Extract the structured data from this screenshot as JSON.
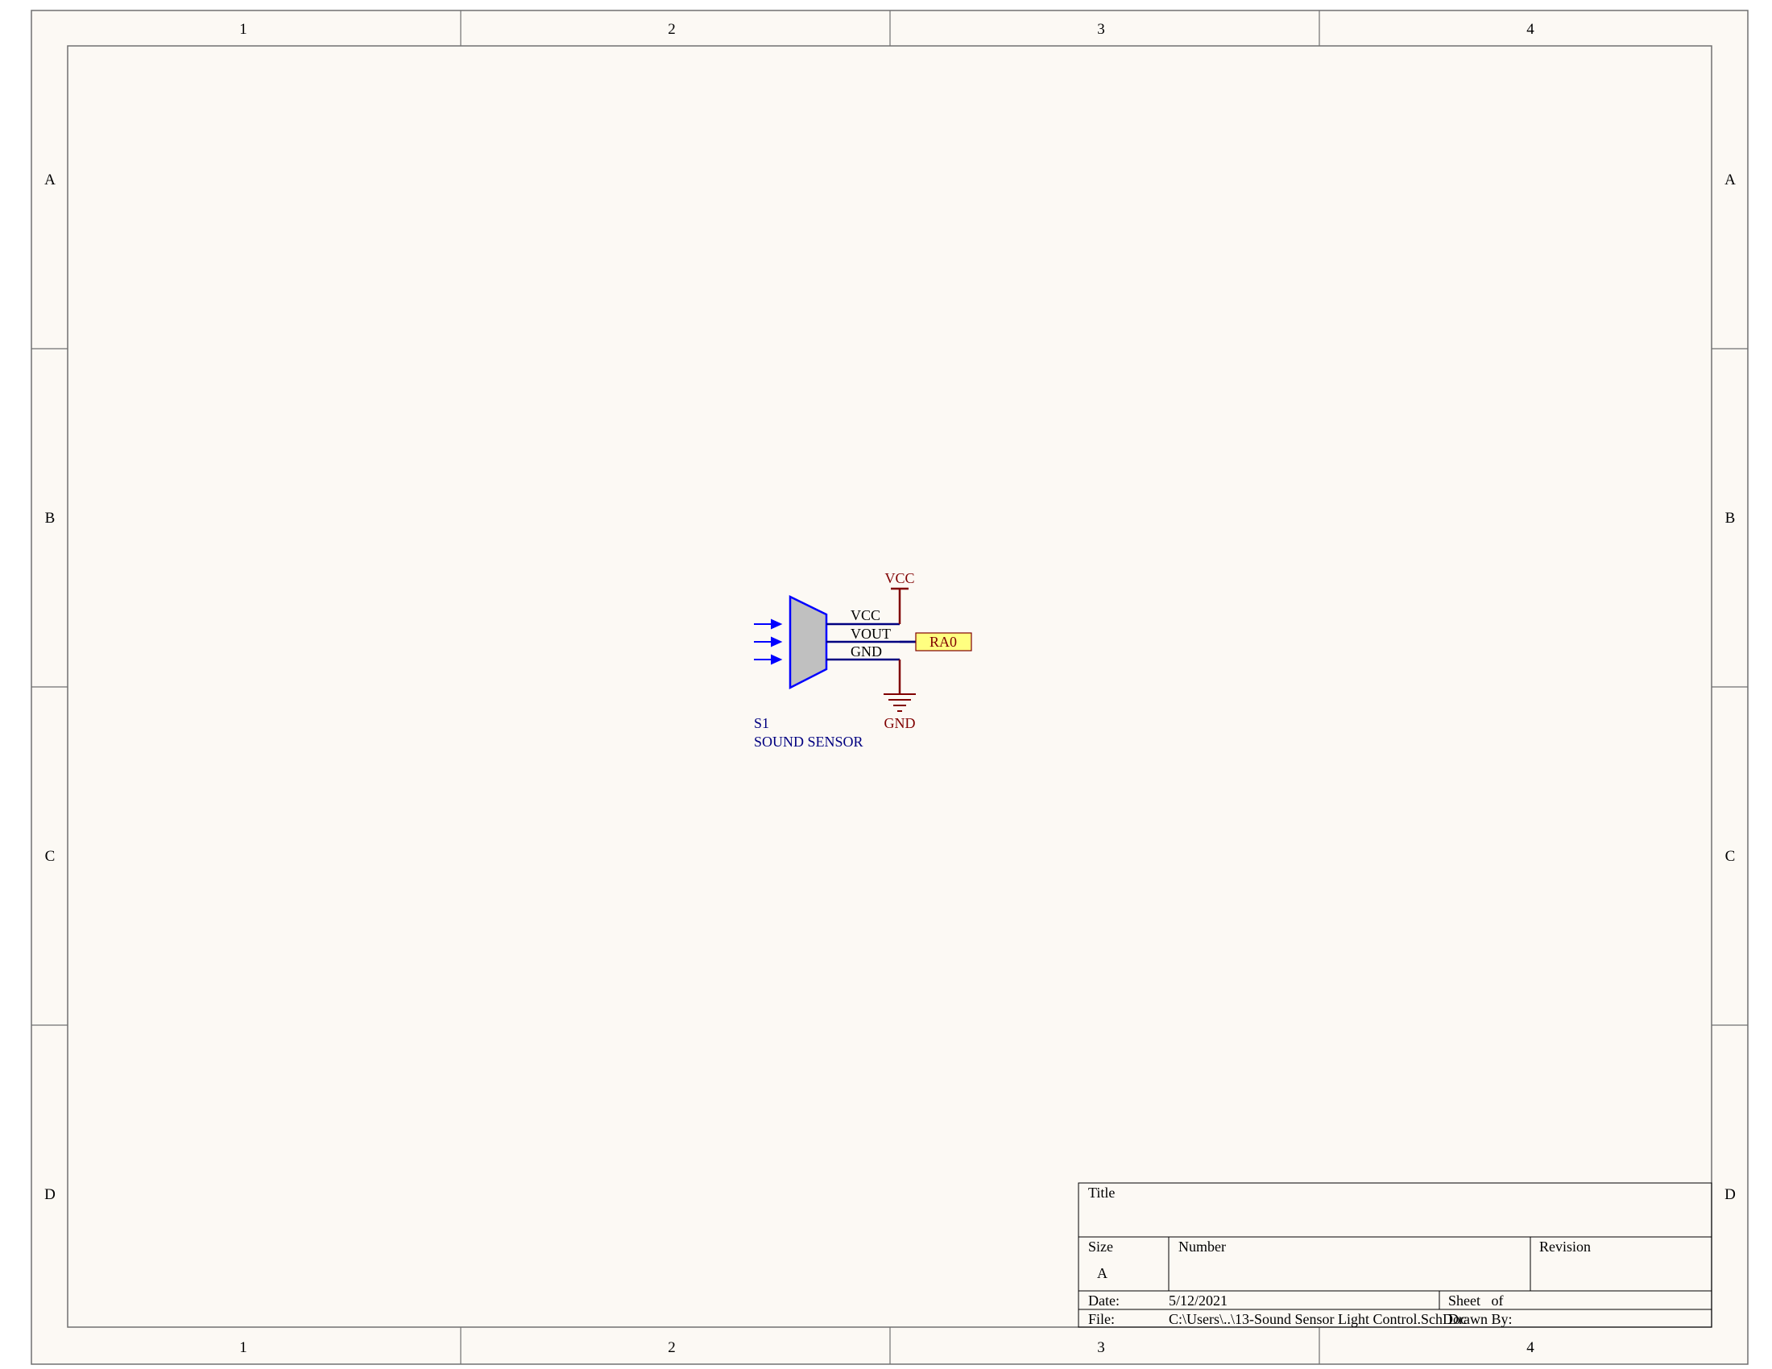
{
  "zones": {
    "columns": [
      "1",
      "2",
      "3",
      "4"
    ],
    "rows": [
      "A",
      "B",
      "C",
      "D"
    ]
  },
  "component": {
    "designator": "S1",
    "comment": "SOUND SENSOR",
    "pins": [
      "VCC",
      "VOUT",
      "GND"
    ]
  },
  "power": {
    "vcc_label": "VCC",
    "gnd_label": "GND"
  },
  "net_port": {
    "label": "RA0"
  },
  "title_block": {
    "title_label": "Title",
    "size_label": "Size",
    "size_value": "A",
    "number_label": "Number",
    "revision_label": "Revision",
    "date_label": "Date:",
    "date_value": "5/12/2021",
    "sheet_label": "Sheet   of",
    "file_label": "File:",
    "file_value": "C:\\Users\\..\\13-Sound Sensor Light Control.SchDoc",
    "drawn_by_label": "Drawn By:"
  },
  "colors": {
    "sheet_background": "#fcf9f4",
    "frame_line": "#707070",
    "component_outline": "#0000ff",
    "component_fill": "#c0c0c0",
    "wire": "#000080",
    "power_symbol": "#800000",
    "port_fill": "#ffff80",
    "port_border": "#800000"
  }
}
